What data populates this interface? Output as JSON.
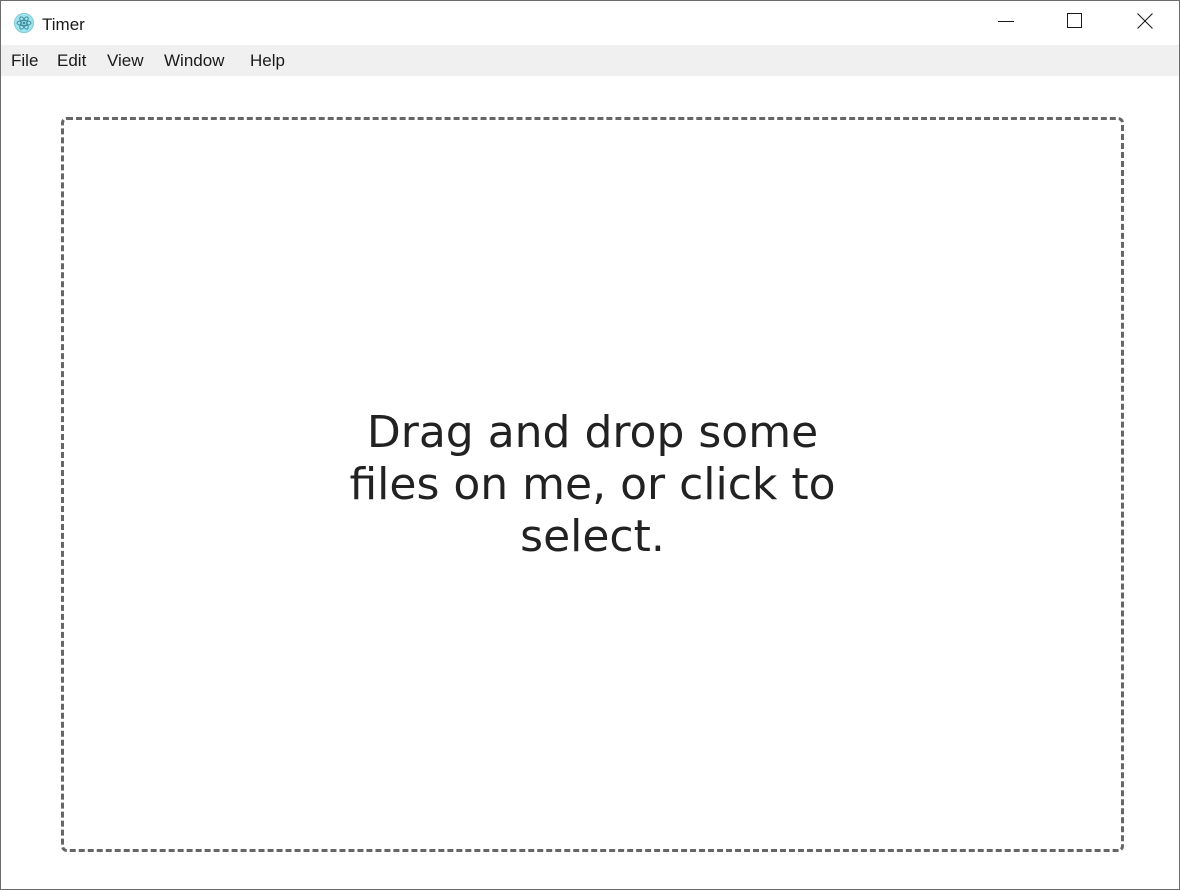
{
  "window": {
    "title": "Timer",
    "app_icon": "electron-atom-icon",
    "controls": {
      "minimize": "minimize-icon",
      "maximize": "maximize-icon",
      "close": "close-icon"
    }
  },
  "menubar": {
    "items": [
      "File",
      "Edit",
      "View",
      "Window",
      "Help"
    ]
  },
  "dropzone": {
    "message": "Drag and drop some files on me, or click to select."
  },
  "colors": {
    "menubar_bg": "#f0f0f0",
    "dropzone_border": "#666666",
    "text": "#222222",
    "icon_accent": "#9fe3ef"
  }
}
